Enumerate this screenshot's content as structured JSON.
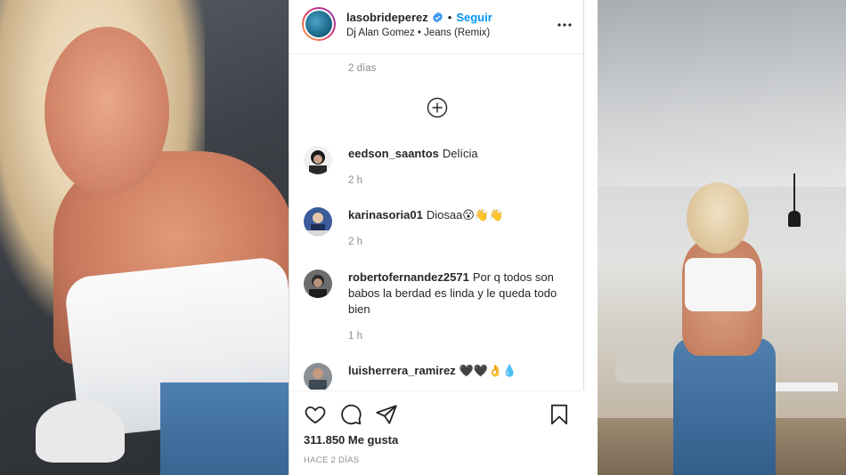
{
  "post": {
    "username": "lasobridеperez",
    "follow_label": "Seguir",
    "dot": "•",
    "audio": "Dj Alan Gomez • Jeans (Remix)",
    "previous_time": "2 días",
    "likes": "311.850 Me gusta",
    "date": "HACE 2 DÍAS"
  },
  "comments": [
    {
      "user": "eedson_saantos",
      "text": "Delícia",
      "time": "2 h"
    },
    {
      "user": "karinasoria01",
      "text": "Diosaa😮👋👋",
      "time": "2 h"
    },
    {
      "user": "robertofernandez2571",
      "text": "Por q todos son babos la berdad es linda y le queda todo bien",
      "time": "1 h"
    },
    {
      "user": "luisherrera_ramirez",
      "text": "🖤🖤👌💧",
      "time": ""
    }
  ],
  "icons": {
    "verified": "verified-badge-icon",
    "more": "more-options-icon",
    "load_more": "plus-circle-icon",
    "like": "heart-icon",
    "comment": "comment-bubble-icon",
    "share": "paper-plane-icon",
    "save": "bookmark-icon"
  },
  "colors": {
    "link_blue": "#0095f6",
    "text": "#262626",
    "muted": "#8e8e8e",
    "border": "#dbdbdb"
  }
}
